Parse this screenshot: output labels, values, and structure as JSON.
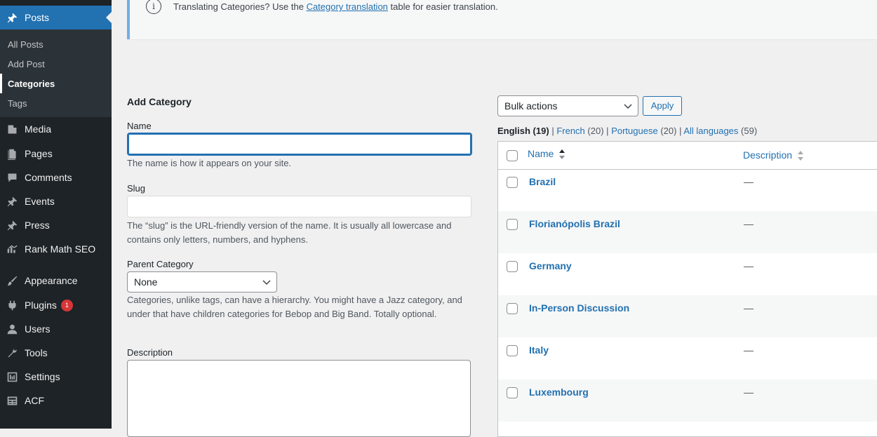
{
  "sidebar": {
    "posts": "Posts",
    "submenu": [
      "All Posts",
      "Add Post",
      "Categories",
      "Tags"
    ],
    "items": [
      {
        "label": "Media",
        "icon": "media-icon"
      },
      {
        "label": "Pages",
        "icon": "pages-icon"
      },
      {
        "label": "Comments",
        "icon": "comments-icon"
      },
      {
        "label": "Events",
        "icon": "pin-icon"
      },
      {
        "label": "Press",
        "icon": "pin-icon"
      },
      {
        "label": "Rank Math SEO",
        "icon": "rank-math-icon"
      },
      {
        "label": "Appearance",
        "icon": "brush-icon"
      },
      {
        "label": "Plugins",
        "icon": "plugin-icon",
        "badge": "1"
      },
      {
        "label": "Users",
        "icon": "user-icon"
      },
      {
        "label": "Tools",
        "icon": "wrench-icon"
      },
      {
        "label": "Settings",
        "icon": "settings-icon"
      },
      {
        "label": "ACF",
        "icon": "acf-icon"
      }
    ]
  },
  "notice": {
    "icon": "info-icon",
    "before": "Translating Categories? Use the ",
    "link": "Category translation",
    "after": " table for easier translation."
  },
  "form": {
    "title": "Add Category",
    "name_label": "Name",
    "name_value": "",
    "name_hint": "The name is how it appears on your site.",
    "slug_label": "Slug",
    "slug_value": "",
    "slug_hint": "The “slug” is the URL-friendly version of the name. It is usually all lowercase and contains only letters, numbers, and hyphens.",
    "parent_label": "Parent Category",
    "parent_value": "None",
    "parent_hint": "Categories, unlike tags, can have a hierarchy. You might have a Jazz category, and under that have children categories for Bebop and Big Band. Totally optional.",
    "description_label": "Description"
  },
  "list": {
    "bulk_value": "Bulk actions",
    "apply": "Apply",
    "filters": {
      "english": "English (19)",
      "sep": "|",
      "french": "French",
      "french_count": "(20)",
      "portuguese": "Portuguese",
      "portuguese_count": "(20)",
      "all": "All languages",
      "all_count": "(59)"
    },
    "columns": {
      "name": "Name",
      "description": "Description"
    },
    "rows": [
      {
        "name": "Brazil",
        "description": "—"
      },
      {
        "name": "Florianópolis Brazil",
        "description": "—"
      },
      {
        "name": "Germany",
        "description": "—"
      },
      {
        "name": "In-Person Discussion",
        "description": "—"
      },
      {
        "name": "Italy",
        "description": "—"
      },
      {
        "name": "Luxembourg",
        "description": "—"
      }
    ]
  },
  "colors": {
    "accent": "#2271b1",
    "sidebar": "#1d2327",
    "badge": "#d63638"
  }
}
